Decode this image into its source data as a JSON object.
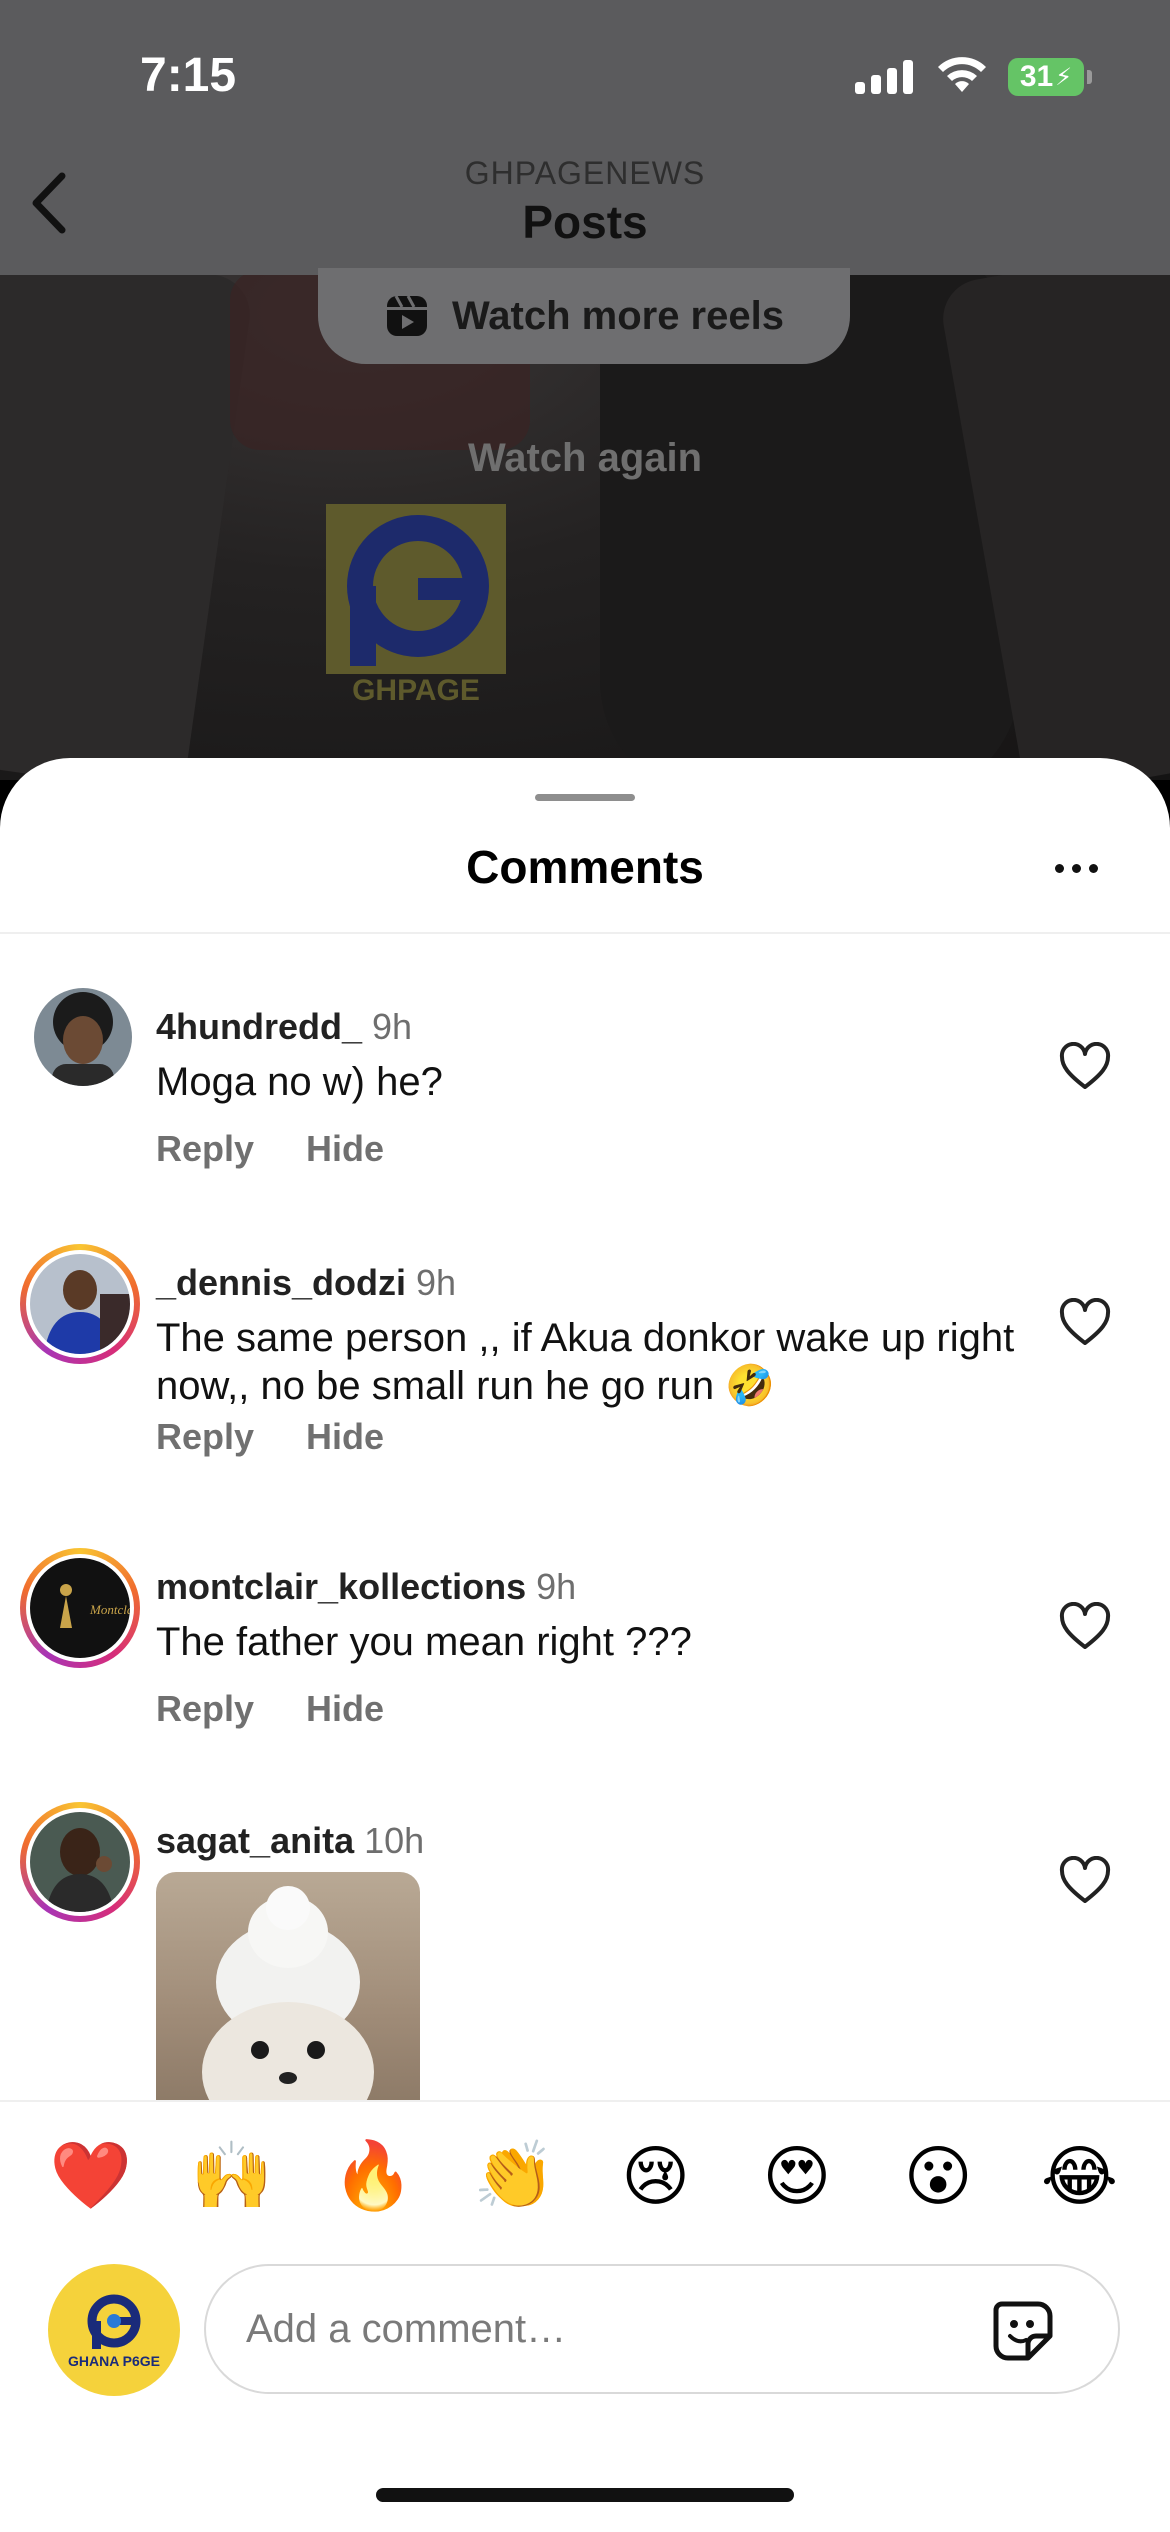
{
  "status_bar": {
    "time": "7:15",
    "battery": "31"
  },
  "nav": {
    "account": "GHPAGENEWS",
    "title": "Posts"
  },
  "reel": {
    "watch_more_label": "Watch more reels",
    "watch_again_label": "Watch again",
    "watermark": "GHPAGE"
  },
  "sheet": {
    "title": "Comments"
  },
  "comments": [
    {
      "username": "4hundredd_",
      "time": "9h",
      "text": "Moga no w) he?",
      "reply": "Reply",
      "hide": "Hide"
    },
    {
      "username": "_dennis_dodzi",
      "time": "9h",
      "text": "The same person ,, if Akua donkor wake up right now,, no be small run he go run 🤣",
      "reply": "Reply",
      "hide": "Hide"
    },
    {
      "username": "montclair_kollections",
      "time": "9h",
      "text": "The father you mean right ???",
      "reply": "Reply",
      "hide": "Hide"
    },
    {
      "username": "sagat_anita",
      "time": "10h"
    }
  ],
  "emoji_reactions": [
    "❤️",
    "🙌",
    "🔥",
    "👏",
    "😢",
    "😍",
    "😮",
    "😂"
  ],
  "composer": {
    "placeholder": "Add a comment…",
    "avatar_label": "GHANA P6GE"
  },
  "icons": [
    "back-chevron-icon",
    "reels-icon",
    "heart-icon",
    "more-dots-icon",
    "sticker-icon"
  ]
}
